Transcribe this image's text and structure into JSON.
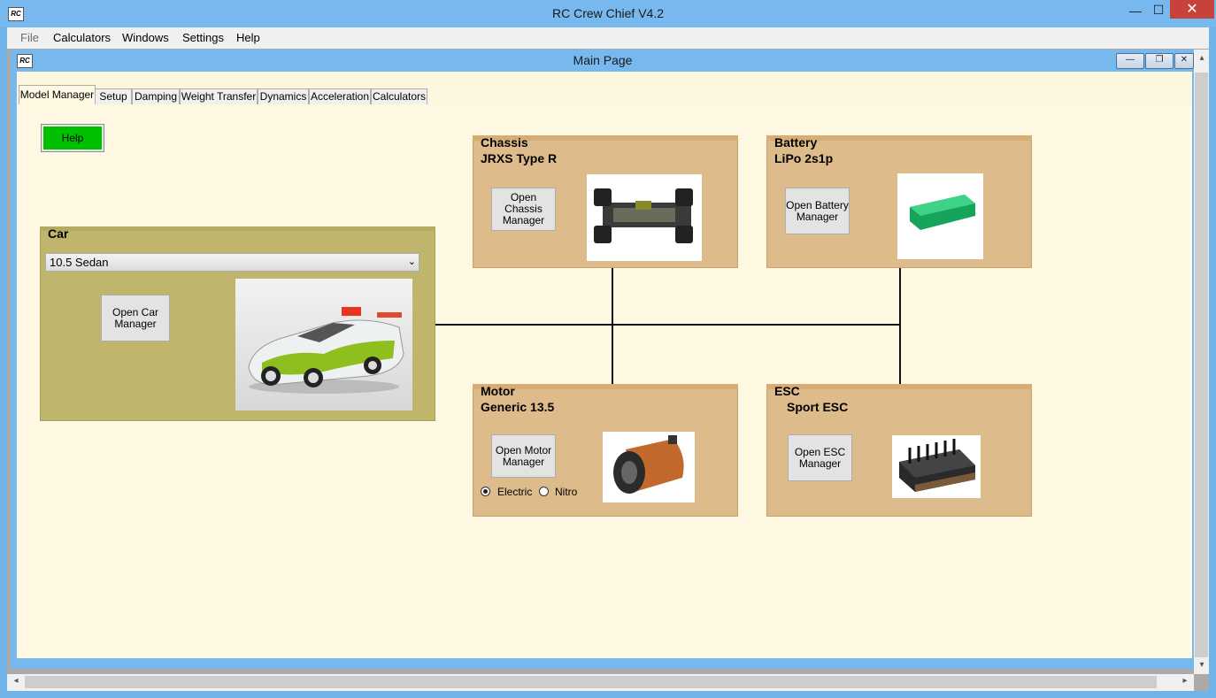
{
  "window": {
    "title": "RC Crew Chief V4.2",
    "icon_text": "RC",
    "min_glyph": "—",
    "max_glyph": "☐",
    "close_glyph": "✕"
  },
  "menu": [
    "File",
    "Calculators",
    "Windows",
    "Settings",
    "Help"
  ],
  "child": {
    "title": "Main Page",
    "icon_text": "RC",
    "min_glyph": "—",
    "max_glyph": "❐",
    "close_glyph": "✕"
  },
  "tabs": [
    "Model Manager",
    "Setup",
    "Damping",
    "Weight Transfer",
    "Dynamics",
    "Acceleration",
    "Calculators"
  ],
  "help_button": "Help",
  "car": {
    "title": "Car",
    "selected": "10.5 Sedan",
    "button": "Open Car Manager"
  },
  "chassis": {
    "title": "Chassis",
    "model": "JRXS Type R",
    "button": "Open Chassis Manager"
  },
  "battery": {
    "title": "Battery",
    "model": "LiPo 2s1p",
    "button": "Open Battery Manager"
  },
  "motor": {
    "title": "Motor",
    "model": "Generic 13.5",
    "button": "Open Motor Manager",
    "options": [
      "Electric",
      "Nitro"
    ],
    "selected_option": "Electric"
  },
  "esc": {
    "title": "ESC",
    "model": "Sport ESC",
    "button": "Open ESC Manager"
  },
  "colors": {
    "panel": "#debb8a",
    "car_panel": "#bfb56d",
    "content_bg": "#fff8e2",
    "help_green": "#00c000",
    "titlebar": "#77b8ee"
  }
}
